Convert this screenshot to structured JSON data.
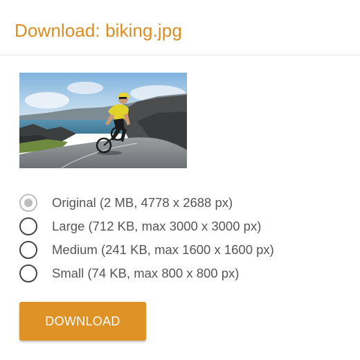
{
  "dialog": {
    "title": "Download: biking.jpg",
    "accent_color": "#df8c1f"
  },
  "preview": {
    "subject": "cyclist on coastal road"
  },
  "size_options": [
    {
      "label": "Original (2 MB, 4778 x 2688 px)",
      "selected": true
    },
    {
      "label": "Large (712 KB, max 3000 x 3000 px)",
      "selected": false
    },
    {
      "label": "Medium (241 KB, max 1600 x 1600 px)",
      "selected": false
    },
    {
      "label": "Small (74 KB, max 800 x 800 px)",
      "selected": false
    }
  ],
  "actions": {
    "download_label": "DOWNLOAD",
    "button_color": "#df9226"
  }
}
